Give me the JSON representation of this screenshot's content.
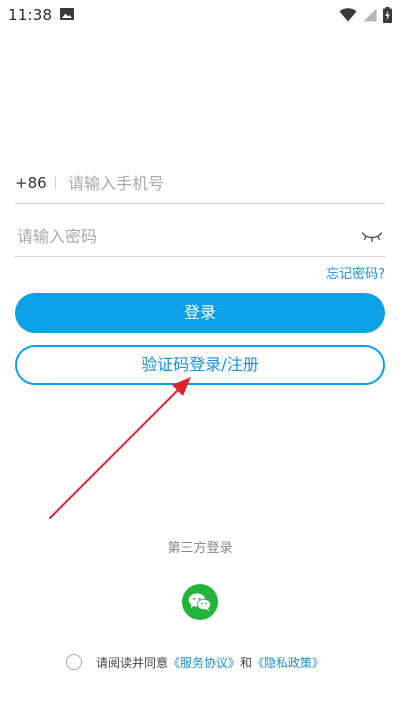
{
  "status_bar": {
    "time": "11:38"
  },
  "login_form": {
    "country_code": "+86",
    "phone_placeholder": "请输入手机号",
    "password_placeholder": "请输入密码",
    "forgot_password": "忘记密码?",
    "login_button": "登录",
    "sms_login_button": "验证码登录/注册"
  },
  "third_party": {
    "label": "第三方登录"
  },
  "agreement": {
    "prefix": "请阅读并同意",
    "service_link": "《服务协议》",
    "conjunction": "和",
    "privacy_link": "《隐私政策》"
  },
  "colors": {
    "accent": "#0ba1e6",
    "link": "#1a90d9",
    "wechat": "#23b43c",
    "annotation_arrow": "#e0232f"
  }
}
